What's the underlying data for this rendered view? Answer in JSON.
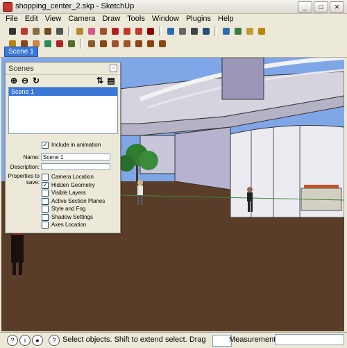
{
  "window": {
    "title": "shopping_center_2.skp - SketchUp"
  },
  "menu": [
    "File",
    "Edit",
    "View",
    "Camera",
    "Draw",
    "Tools",
    "Window",
    "Plugins",
    "Help"
  ],
  "toolbar1": [
    {
      "icon": "select-arrow-icon",
      "color": "#333333"
    },
    {
      "icon": "pencil-icon",
      "color": "#c0392b"
    },
    {
      "icon": "rectangle-icon",
      "color": "#8a6d3b"
    },
    {
      "icon": "circle-icon",
      "color": "#7a4a1e"
    },
    {
      "icon": "arc-icon",
      "color": "#555555"
    },
    {
      "icon": "make-component-icon",
      "color": "#b48a2e"
    },
    {
      "icon": "eraser-icon",
      "color": "#d45a8a"
    },
    {
      "icon": "paint-bucket-icon",
      "color": "#a0522d"
    },
    {
      "icon": "push-pull-icon",
      "color": "#b22222"
    },
    {
      "icon": "move-icon",
      "color": "#c0392b"
    },
    {
      "icon": "rotate-icon",
      "color": "#c0392b"
    },
    {
      "icon": "offset-icon",
      "color": "#8b0000"
    },
    {
      "icon": "orbit-icon",
      "color": "#2b6cb0"
    },
    {
      "icon": "pan-icon",
      "color": "#666666"
    },
    {
      "icon": "zoom-icon",
      "color": "#444444"
    },
    {
      "icon": "zoom-extents-icon",
      "color": "#2a4d7a"
    },
    {
      "icon": "get-models-icon",
      "color": "#2b6cb0"
    },
    {
      "icon": "share-model-icon",
      "color": "#3a7d44"
    },
    {
      "icon": "get-photo-icon",
      "color": "#c79a2e"
    },
    {
      "icon": "photo-texture-icon",
      "color": "#b8860b"
    }
  ],
  "toolbar2": [
    {
      "icon": "walk-icon",
      "color": "#b8860b"
    },
    {
      "icon": "look-around-icon",
      "color": "#8b4513"
    },
    {
      "icon": "position-camera-icon",
      "color": "#cd853f"
    },
    {
      "icon": "section-plane-icon",
      "color": "#2e8b57"
    },
    {
      "icon": "axes-icon",
      "color": "#b22222"
    },
    {
      "icon": "dimension-icon",
      "color": "#556b2f"
    },
    {
      "icon": "layer-manager-icon",
      "color": "#8b5a2b"
    },
    {
      "icon": "iso-view-icon",
      "color": "#8b4513"
    },
    {
      "icon": "top-view-icon",
      "color": "#a0522d"
    },
    {
      "icon": "front-view-icon",
      "color": "#a0522d"
    },
    {
      "icon": "right-view-icon",
      "color": "#8b4513"
    },
    {
      "icon": "back-view-icon",
      "color": "#8b4513"
    },
    {
      "icon": "left-view-icon",
      "color": "#8b4513"
    }
  ],
  "scene_tab": "Scene 1",
  "scenes_panel": {
    "title": "Scenes",
    "list": [
      "Scene 1"
    ],
    "include_in_animation": {
      "label": "Include in animation",
      "checked": true
    },
    "name_label": "Name:",
    "name_value": "Scene 1",
    "description_label": "Description:",
    "description_value": "",
    "properties_label": "Properties to save:",
    "properties": [
      {
        "label": "Camera Location",
        "checked": false
      },
      {
        "label": "Hidden Geometry",
        "checked": true
      },
      {
        "label": "Visible Layers",
        "checked": false
      },
      {
        "label": "Active Section Planes",
        "checked": false
      },
      {
        "label": "Style and Fog",
        "checked": false
      },
      {
        "label": "Shadow Settings",
        "checked": false
      },
      {
        "label": "Axes Location",
        "checked": false
      }
    ]
  },
  "status": {
    "hint": "Select objects. Shift to extend select. Drag mo",
    "measurements_label": "Measurements",
    "measurements_value": ""
  },
  "colors": {
    "sky": "#7fa7e8",
    "ground": "#5a3d28",
    "selection": "#3a78d8"
  }
}
